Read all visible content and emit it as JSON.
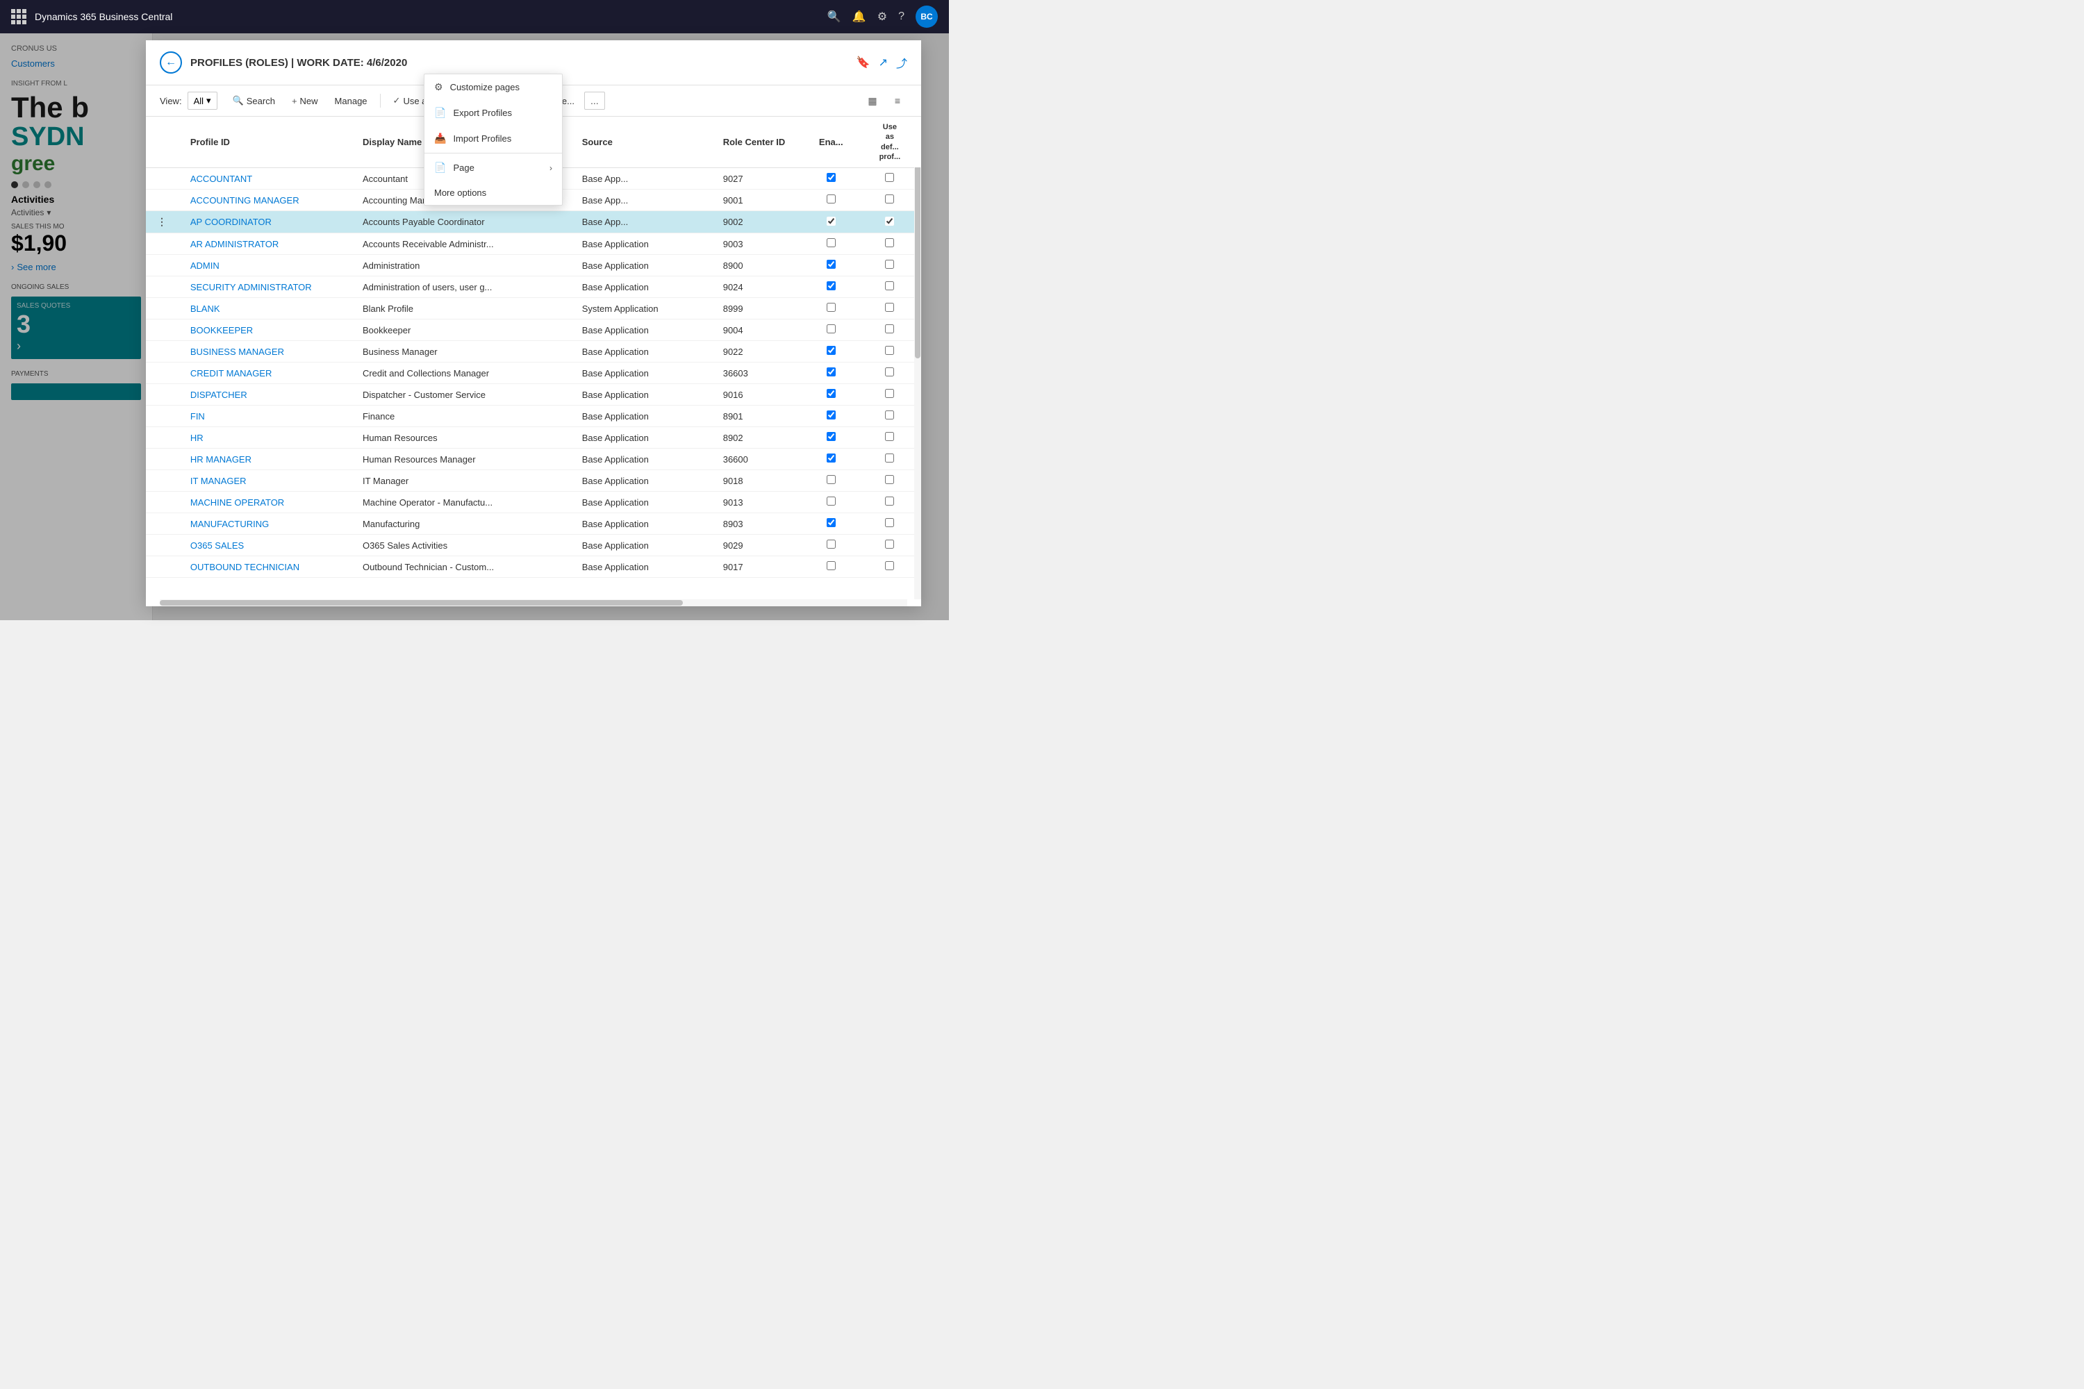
{
  "topbar": {
    "app_title": "Dynamics 365 Business Central",
    "avatar_label": "BC"
  },
  "background": {
    "breadcrumb": "CRONUS US",
    "nav_items": [
      "Customers"
    ],
    "insight_label": "INSIGHT FROM L",
    "big_text_line1": "The b",
    "big_text_teal": "SYDN",
    "big_text_green": "gree",
    "activities_title": "Activities",
    "activities_sub": "Activities",
    "sales_this_month": "SALES THIS MO",
    "amount": "$1,90",
    "see_more": "See more",
    "ongoing_sales": "ONGOING SALES",
    "sales_quotes_label": "SALES QUOTES",
    "sales_quotes_count": "3",
    "payments_label": "PAYMENTS"
  },
  "modal": {
    "title": "PROFILES (ROLES) | WORK DATE: 4/6/2020",
    "toolbar": {
      "view_label": "View:",
      "all_label": "All",
      "search_label": "Search",
      "new_label": "New",
      "manage_label": "Manage",
      "use_default_label": "Use as default profile",
      "copy_profile_label": "Copy profile...",
      "more_label": "..."
    },
    "table": {
      "columns": [
        {
          "key": "profile_id",
          "label": "Profile ID"
        },
        {
          "key": "display_name",
          "label": "Display Name",
          "sortable": true,
          "sort_dir": "asc"
        },
        {
          "key": "source",
          "label": "Source"
        },
        {
          "key": "role_center_id",
          "label": "Role Center ID"
        },
        {
          "key": "enabled",
          "label": "Ena..."
        },
        {
          "key": "use_as_default",
          "label": "Use as def... prof..."
        }
      ],
      "rows": [
        {
          "profile_id": "ACCOUNTANT",
          "display_name": "Accountant",
          "source": "Base App...",
          "role_center_id": "9027",
          "enabled": true,
          "use_as_default": false,
          "selected": false
        },
        {
          "profile_id": "ACCOUNTING MANAGER",
          "display_name": "Accounting Manager",
          "source": "Base App...",
          "role_center_id": "9001",
          "enabled": false,
          "use_as_default": false,
          "selected": false
        },
        {
          "profile_id": "AP COORDINATOR",
          "display_name": "Accounts Payable Coordinator",
          "source": "Base App...",
          "role_center_id": "9002",
          "enabled": true,
          "use_as_default": true,
          "selected": true
        },
        {
          "profile_id": "AR ADMINISTRATOR",
          "display_name": "Accounts Receivable Administr...",
          "source": "Base Application",
          "role_center_id": "9003",
          "enabled": false,
          "use_as_default": false,
          "selected": false
        },
        {
          "profile_id": "ADMIN",
          "display_name": "Administration",
          "source": "Base Application",
          "role_center_id": "8900",
          "enabled": true,
          "use_as_default": false,
          "selected": false
        },
        {
          "profile_id": "SECURITY ADMINISTRATOR",
          "display_name": "Administration of users, user g...",
          "source": "Base Application",
          "role_center_id": "9024",
          "enabled": true,
          "use_as_default": false,
          "selected": false
        },
        {
          "profile_id": "BLANK",
          "display_name": "Blank Profile",
          "source": "System Application",
          "role_center_id": "8999",
          "enabled": false,
          "use_as_default": false,
          "selected": false
        },
        {
          "profile_id": "BOOKKEEPER",
          "display_name": "Bookkeeper",
          "source": "Base Application",
          "role_center_id": "9004",
          "enabled": false,
          "use_as_default": false,
          "selected": false
        },
        {
          "profile_id": "BUSINESS MANAGER",
          "display_name": "Business Manager",
          "source": "Base Application",
          "role_center_id": "9022",
          "enabled": true,
          "use_as_default": false,
          "selected": false
        },
        {
          "profile_id": "CREDIT MANAGER",
          "display_name": "Credit and Collections Manager",
          "source": "Base Application",
          "role_center_id": "36603",
          "enabled": true,
          "use_as_default": false,
          "selected": false
        },
        {
          "profile_id": "DISPATCHER",
          "display_name": "Dispatcher - Customer Service",
          "source": "Base Application",
          "role_center_id": "9016",
          "enabled": true,
          "use_as_default": false,
          "selected": false
        },
        {
          "profile_id": "FIN",
          "display_name": "Finance",
          "source": "Base Application",
          "role_center_id": "8901",
          "enabled": true,
          "use_as_default": false,
          "selected": false
        },
        {
          "profile_id": "HR",
          "display_name": "Human Resources",
          "source": "Base Application",
          "role_center_id": "8902",
          "enabled": true,
          "use_as_default": false,
          "selected": false
        },
        {
          "profile_id": "HR MANAGER",
          "display_name": "Human Resources Manager",
          "source": "Base Application",
          "role_center_id": "36600",
          "enabled": true,
          "use_as_default": false,
          "selected": false
        },
        {
          "profile_id": "IT MANAGER",
          "display_name": "IT Manager",
          "source": "Base Application",
          "role_center_id": "9018",
          "enabled": false,
          "use_as_default": false,
          "selected": false
        },
        {
          "profile_id": "MACHINE OPERATOR",
          "display_name": "Machine Operator - Manufactu...",
          "source": "Base Application",
          "role_center_id": "9013",
          "enabled": false,
          "use_as_default": false,
          "selected": false
        },
        {
          "profile_id": "MANUFACTURING",
          "display_name": "Manufacturing",
          "source": "Base Application",
          "role_center_id": "8903",
          "enabled": true,
          "use_as_default": false,
          "selected": false
        },
        {
          "profile_id": "O365 SALES",
          "display_name": "O365 Sales Activities",
          "source": "Base Application",
          "role_center_id": "9029",
          "enabled": false,
          "use_as_default": false,
          "selected": false
        },
        {
          "profile_id": "OUTBOUND TECHNICIAN",
          "display_name": "Outbound Technician - Custom...",
          "source": "Base Application",
          "role_center_id": "9017",
          "enabled": false,
          "use_as_default": false,
          "selected": false
        }
      ]
    }
  },
  "context_menu": {
    "items": [
      {
        "icon": "⚙",
        "label": "Customize pages",
        "has_arrow": false
      },
      {
        "icon": "📄",
        "label": "Export Profiles",
        "has_arrow": false
      },
      {
        "icon": "📥",
        "label": "Import Profiles",
        "has_arrow": false
      },
      {
        "icon": "📄",
        "label": "Page",
        "has_arrow": true
      },
      {
        "icon": "",
        "label": "More options",
        "has_arrow": false
      }
    ]
  },
  "icons": {
    "search": "🔍",
    "new": "+",
    "filter": "⊟",
    "list": "≡",
    "back_arrow": "←",
    "bookmark": "🔖",
    "open_new": "↗",
    "maximize": "⤢",
    "chevron_down": "▾",
    "chevron_right": "›",
    "dots_vertical": "⋮"
  }
}
